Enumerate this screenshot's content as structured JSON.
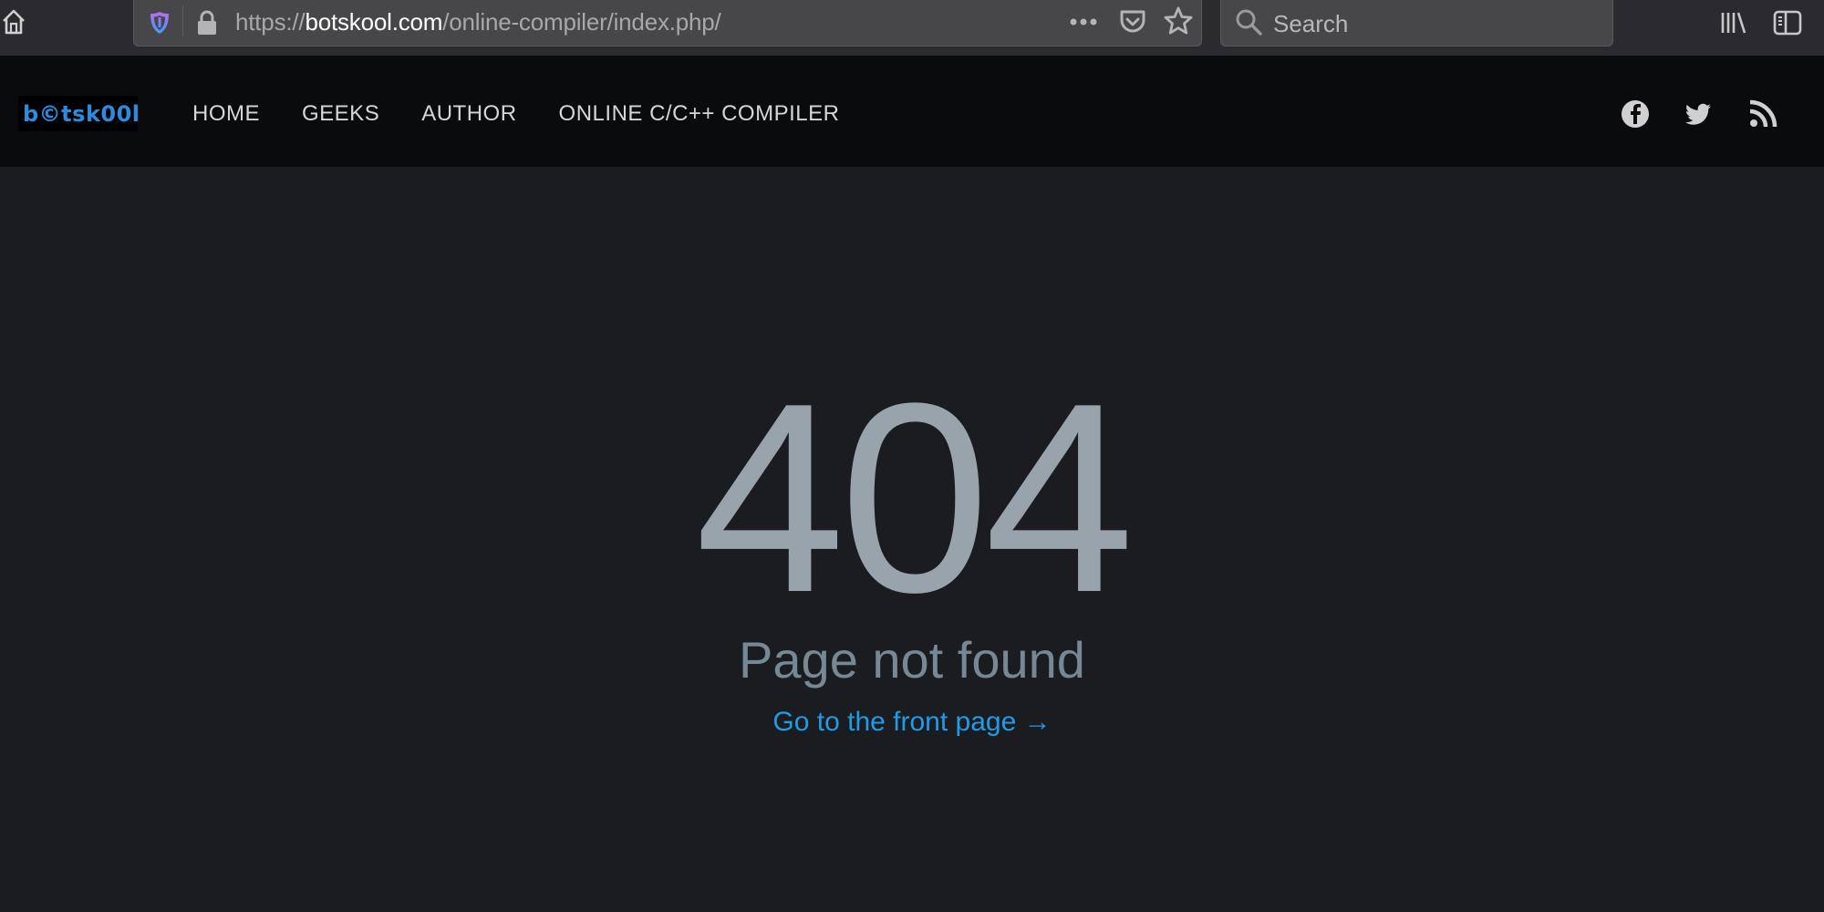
{
  "browser": {
    "url_prefix": "https://",
    "url_host": "botskool.com",
    "url_path": "/online-compiler/index.php/",
    "search_placeholder": "Search",
    "icons": [
      "home-icon",
      "tracking-shield-icon",
      "lock-icon",
      "page-actions-icon",
      "pocket-icon",
      "bookmark-star-icon",
      "search-icon",
      "library-icon",
      "sidebar-icon"
    ]
  },
  "site": {
    "logo_text": "b©tsk00l",
    "logo_color": "#2a8be0",
    "nav": [
      {
        "label": "HOME"
      },
      {
        "label": "GEEKS"
      },
      {
        "label": "AUTHOR"
      },
      {
        "label": "ONLINE C/C++ COMPILER"
      }
    ],
    "social": [
      "facebook-icon",
      "twitter-icon",
      "rss-icon"
    ]
  },
  "error": {
    "code": "404",
    "message": "Page not found",
    "link_label": "Go to the front page →",
    "link_color": "#1e9ce8"
  }
}
